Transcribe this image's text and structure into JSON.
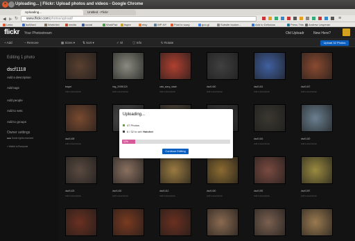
{
  "window": {
    "title": "Uploading... | Flickr: Upload photos and videos - Google Chrome"
  },
  "tabs": [
    {
      "label": "Uploading..."
    },
    {
      "label": "Untitled - Flickr"
    }
  ],
  "toolbar": {
    "url_host": "www.flickr.com",
    "url_path": "/photos/upload/"
  },
  "bookmarks": [
    {
      "label": "Links",
      "color": "#e05a2b"
    },
    {
      "label": "isoWord",
      "color": "#3b6fc4"
    },
    {
      "label": "Work/dev",
      "color": "#7a6f58"
    },
    {
      "label": "media",
      "color": "#b84b2f"
    },
    {
      "label": "social",
      "color": "#3b5998"
    },
    {
      "label": "WorkPad",
      "color": "#4a9a4a"
    },
    {
      "label": "fwpre",
      "color": "#c9a227"
    },
    {
      "label": "etsy",
      "color": "#e87a2b"
    },
    {
      "label": "WP-NY",
      "color": "#5f7f9f"
    },
    {
      "label": "Post to sowy",
      "color": "#e05a2b"
    },
    {
      "label": "goo.gl",
      "color": "#4285f4"
    },
    {
      "label": "Subsite bookm...",
      "color": "#888888"
    },
    {
      "label": "Add to Delicious",
      "color": "#3274d1"
    },
    {
      "label": "Press This",
      "color": "#21759b"
    },
    {
      "label": "Andrew Lesperan",
      "color": "#666666"
    }
  ],
  "flickr": {
    "logo": "flickr",
    "photostream": "Your Photostream",
    "nav": {
      "old_uploadr": "Old Uploadr",
      "new_here": "New Here?"
    }
  },
  "actions": {
    "add": "Add",
    "remove": "Remove",
    "sizes": "Sizes",
    "sort": "Sort",
    "select": "Sl",
    "info": "Info",
    "rotate": "Rotate",
    "upload": "Upload 32 Photos"
  },
  "sidebar": {
    "editing": "Editing 1 photo",
    "photo_title": "dscf1118",
    "add_description": "Add a description",
    "add_tags": "Add tags",
    "add_people": "Add people",
    "add_sets": "Add to sets",
    "add_groups": "Add to groups",
    "owner_settings": "Owner settings",
    "license": "Some rights reserved",
    "privacy": "Visible to Everyone"
  },
  "photos": [
    {
      "name": "teapot",
      "desc": "Add a description",
      "color": "#5a4030"
    },
    {
      "name": "img_20090120",
      "desc": "Add a description",
      "color": "#8a8a80"
    },
    {
      "name": "cats_wavy_stash",
      "desc": "Add a description",
      "color": "#b04030"
    },
    {
      "name": "dscf1400",
      "desc": "Add a description",
      "color": "#404040"
    },
    {
      "name": "dscf1401",
      "desc": "Add a description",
      "color": "#4060a0"
    },
    {
      "name": "dscf1407",
      "desc": "Add a description",
      "color": "#8a4a30"
    },
    {
      "name": "dscf1409",
      "desc": "Add a description",
      "color": "#7a4a30"
    },
    {
      "name": "",
      "desc": "",
      "color": "#555555"
    },
    {
      "name": "",
      "desc": "",
      "color": "#5a5040"
    },
    {
      "name": "",
      "desc": "",
      "color": "#404040"
    },
    {
      "name": "dscf1416",
      "desc": "Add a description",
      "color": "#3a3830"
    },
    {
      "name": "dscf1420",
      "desc": "Add a description",
      "color": "#6a8090"
    },
    {
      "name": "dscf1423",
      "desc": "Add a description",
      "color": "#5a4a40"
    },
    {
      "name": "dscf1430",
      "desc": "Add a description",
      "color": "#8a7060"
    },
    {
      "name": "dscf1412",
      "desc": "Add a description",
      "color": "#9a7a40"
    },
    {
      "name": "dscf1400",
      "desc": "Add a description",
      "color": "#8a6a30"
    },
    {
      "name": "dscf1392",
      "desc": "Add a description",
      "color": "#7a4a40"
    },
    {
      "name": "dscf1397",
      "desc": "Add a description",
      "color": "#9a8a40"
    },
    {
      "name": "",
      "desc": "",
      "color": "#6a3020"
    },
    {
      "name": "",
      "desc": "",
      "color": "#7a3a20"
    },
    {
      "name": "",
      "desc": "",
      "color": "#6a3020"
    },
    {
      "name": "",
      "desc": "",
      "color": "#8a6a50"
    },
    {
      "name": "",
      "desc": "",
      "color": "#7a6050"
    },
    {
      "name": "",
      "desc": "",
      "color": "#9a7a50"
    }
  ],
  "modal": {
    "title": "Uploading...",
    "row1": "47 Photos",
    "row2_prefix": "6 / 32 to set:",
    "row2_set": "Hatchet",
    "progress_fraction": 0.12,
    "progress_text": "12%",
    "continue": "Continue Editing"
  }
}
